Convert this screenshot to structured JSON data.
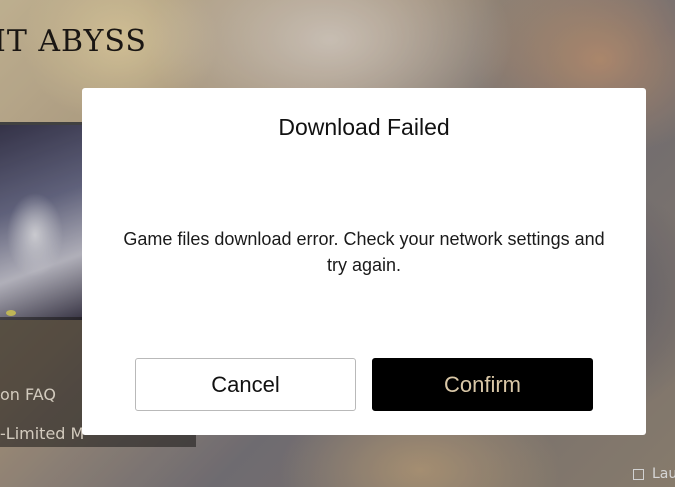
{
  "background": {
    "logo_text": "IT ABYSS",
    "side_menu": {
      "items": [
        {
          "label": "on FAQ"
        },
        {
          "label": "-Limited M"
        }
      ]
    },
    "launch_option": {
      "label": "Lau"
    }
  },
  "dialog": {
    "title": "Download Failed",
    "message": "Game files download error. Check your network settings and try again.",
    "cancel_label": "Cancel",
    "confirm_label": "Confirm"
  },
  "colors": {
    "confirm_bg": "#000000",
    "confirm_text": "#d9c7a7",
    "dialog_bg": "#ffffff"
  }
}
